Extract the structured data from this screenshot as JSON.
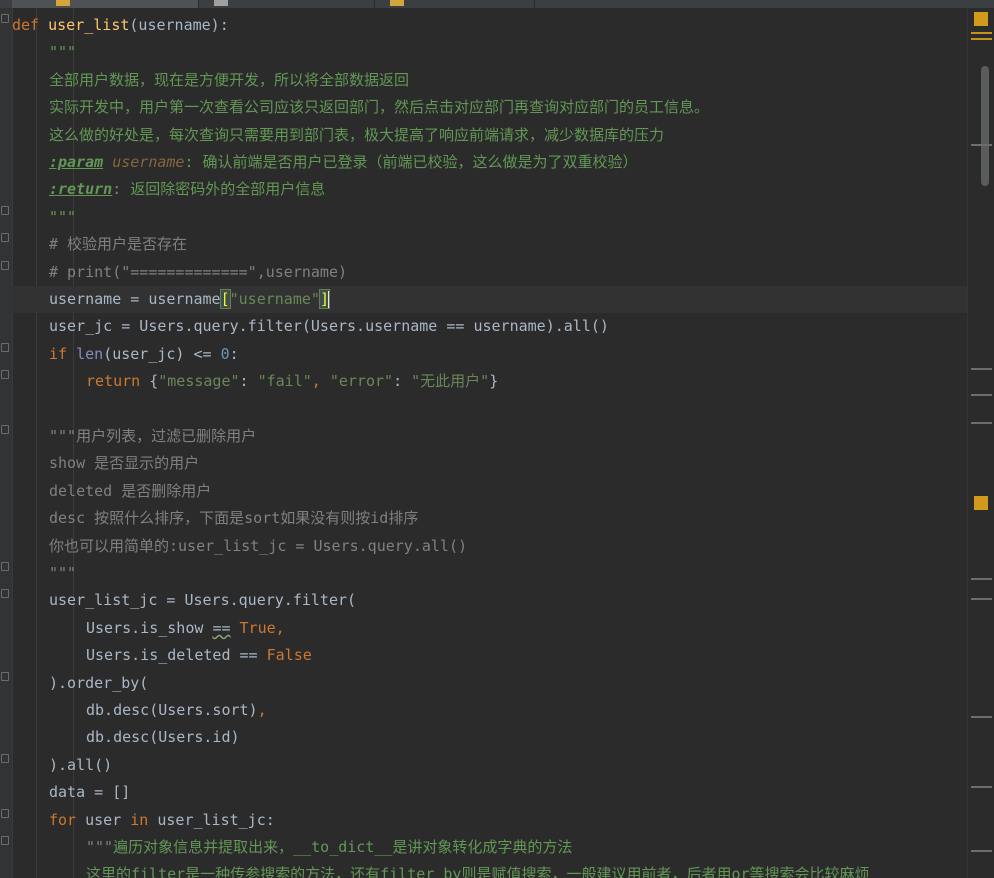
{
  "editor": {
    "language": "python",
    "theme": "darcula",
    "lines": [
      {
        "indent": 0,
        "fold": true,
        "tokens": [
          [
            "def ",
            "kw"
          ],
          [
            "user_list",
            "fn"
          ],
          [
            "(username):",
            "plain"
          ]
        ]
      },
      {
        "indent": 1,
        "fold": false,
        "tokens": [
          [
            "\"\"\"",
            "doc"
          ]
        ]
      },
      {
        "indent": 1,
        "fold": false,
        "tokens": [
          [
            "全部用户数据，现在是方便开发，所以将全部数据返回",
            "doc"
          ]
        ]
      },
      {
        "indent": 1,
        "fold": false,
        "tokens": [
          [
            "实际开发中，用户第一次查看公司应该只返回部门，然后点击对应部门再查询对应部门的员工信息。",
            "doc"
          ]
        ]
      },
      {
        "indent": 1,
        "fold": false,
        "tokens": [
          [
            "这么做的好处是，每次查询只需要用到部门表，极大提高了响应前端请求，减少数据库的压力",
            "doc"
          ]
        ]
      },
      {
        "indent": 1,
        "fold": false,
        "tokens": [
          [
            ":param",
            "doctag"
          ],
          [
            " username",
            "docparam"
          ],
          [
            ": 确认前端是否用户已登录（前端已校验，这么做是为了双重校验）",
            "doc"
          ]
        ]
      },
      {
        "indent": 1,
        "fold": false,
        "tokens": [
          [
            ":return",
            "doctag"
          ],
          [
            ": 返回除密码外的全部用户信息",
            "doc"
          ]
        ]
      },
      {
        "indent": 1,
        "fold": true,
        "tokens": [
          [
            "\"\"\"",
            "doc"
          ]
        ]
      },
      {
        "indent": 1,
        "fold": true,
        "tokens": [
          [
            "# 校验用户是否存在",
            "cmt"
          ]
        ]
      },
      {
        "indent": 1,
        "fold": true,
        "tokens": [
          [
            "# print(\"=============\",username)",
            "cmt"
          ]
        ]
      },
      {
        "indent": 1,
        "fold": false,
        "current": true,
        "tokens": [
          [
            "username = username",
            "plain"
          ],
          [
            "[",
            "bracket"
          ],
          [
            "\"username\"",
            "str"
          ],
          [
            "]",
            "bracket"
          ]
        ]
      },
      {
        "indent": 1,
        "fold": false,
        "tokens": [
          [
            "user_jc = Users.query.filter(Users.username == username).all()",
            "plain"
          ]
        ]
      },
      {
        "indent": 1,
        "fold": true,
        "tokens": [
          [
            "if ",
            "kw"
          ],
          [
            "len",
            "bi"
          ],
          [
            "(user_jc) <= ",
            "plain"
          ],
          [
            "0",
            "num"
          ],
          [
            ":",
            "plain"
          ]
        ]
      },
      {
        "indent": 2,
        "fold": true,
        "tokens": [
          [
            "return ",
            "kw"
          ],
          [
            "{",
            "plain"
          ],
          [
            "\"message\"",
            "str"
          ],
          [
            ": ",
            "plain"
          ],
          [
            "\"fail\"",
            "str"
          ],
          [
            ", ",
            "kw"
          ],
          [
            "\"error\"",
            "str"
          ],
          [
            ": ",
            "plain"
          ],
          [
            "\"无此用户\"",
            "str"
          ],
          [
            "}",
            "plain"
          ]
        ]
      },
      {
        "indent": 0,
        "fold": false,
        "tokens": []
      },
      {
        "indent": 1,
        "fold": true,
        "tokens": [
          [
            "\"\"\"用户列表，过滤已删除用户",
            "cmt"
          ]
        ]
      },
      {
        "indent": 1,
        "fold": false,
        "tokens": [
          [
            "show 是否显示的用户",
            "cmt"
          ]
        ]
      },
      {
        "indent": 1,
        "fold": false,
        "tokens": [
          [
            "deleted 是否删除用户",
            "cmt"
          ]
        ]
      },
      {
        "indent": 1,
        "fold": false,
        "tokens": [
          [
            "desc 按照什么排序，下面是sort如果没有则按id排序",
            "cmt"
          ]
        ]
      },
      {
        "indent": 1,
        "fold": false,
        "tokens": [
          [
            "你也可以用简单的:user_list_jc = Users.query.all()",
            "cmt"
          ]
        ]
      },
      {
        "indent": 1,
        "fold": true,
        "tokens": [
          [
            "\"\"\"",
            "cmt"
          ]
        ]
      },
      {
        "indent": 1,
        "fold": true,
        "tokens": [
          [
            "user_list_jc = Users.query.filter(",
            "plain"
          ]
        ]
      },
      {
        "indent": 2,
        "fold": false,
        "tokens": [
          [
            "Users.is_show ",
            "plain"
          ],
          [
            "==",
            "squig"
          ],
          [
            " ",
            "plain"
          ],
          [
            "True",
            "kw"
          ],
          [
            ",",
            "kw"
          ]
        ]
      },
      {
        "indent": 2,
        "fold": false,
        "tokens": [
          [
            "Users.is_deleted == ",
            "plain"
          ],
          [
            "False",
            "kw"
          ]
        ]
      },
      {
        "indent": 1,
        "fold": true,
        "tokens": [
          [
            ").order_by(",
            "plain"
          ]
        ]
      },
      {
        "indent": 2,
        "fold": false,
        "tokens": [
          [
            "db.desc(Users.sort)",
            "plain"
          ],
          [
            ",",
            "kw"
          ]
        ]
      },
      {
        "indent": 2,
        "fold": false,
        "tokens": [
          [
            "db.desc(Users.id)",
            "plain"
          ]
        ]
      },
      {
        "indent": 1,
        "fold": true,
        "tokens": [
          [
            ").all()",
            "plain"
          ]
        ]
      },
      {
        "indent": 1,
        "fold": false,
        "tokens": [
          [
            "data = []",
            "plain"
          ]
        ]
      },
      {
        "indent": 1,
        "fold": true,
        "tokens": [
          [
            "for ",
            "kw"
          ],
          [
            "user ",
            "plain"
          ],
          [
            "in ",
            "kw"
          ],
          [
            "user_list_jc:",
            "plain"
          ]
        ]
      },
      {
        "indent": 2,
        "fold": true,
        "tokens": [
          [
            "\"\"\"",
            "cmt"
          ],
          [
            "遍历对象信息并提取出来，__to_dict__是讲对象转化成字典的方法",
            "doc"
          ]
        ]
      },
      {
        "indent": 2,
        "fold": false,
        "tokens": [
          [
            "这里的filter是一种传参搜索的方法，还有filter_by则是赋值搜索，一般建议用前者，后者用or等搜索会比较麻烦",
            "doc"
          ]
        ]
      }
    ]
  },
  "colors": {
    "background": "#2b2b2b",
    "keyword": "#cc7832",
    "function": "#ffc66d",
    "string": "#6a8759",
    "comment": "#808080",
    "number": "#6897bb",
    "warning": "#d29a1c"
  }
}
